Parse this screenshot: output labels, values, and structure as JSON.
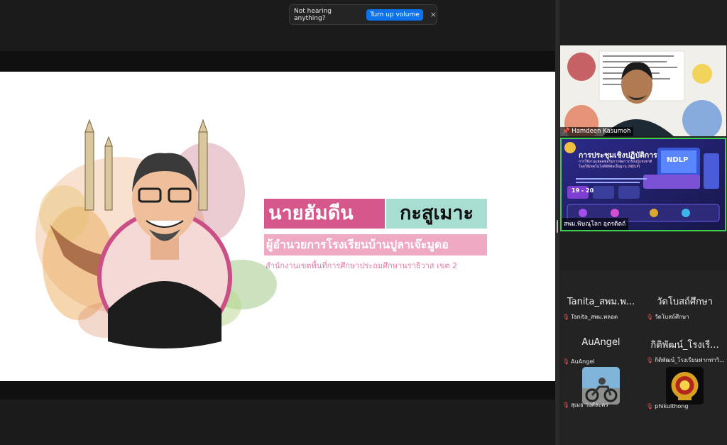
{
  "notification": {
    "message": "Not hearing anything?",
    "action_label": "Turn up volume",
    "close_glyph": "×"
  },
  "slide": {
    "first_name": "นายฮัมดีน",
    "last_name": "กะสูเมาะ",
    "position": "ผู้อำนวยการโรงเรียนบ้านปูลาเจ๊ะมูดอ",
    "office": "สำนักงานเขตพื้นที่การศึกษาประถมศึกษานราธิวาส เขต 2",
    "colors": {
      "pink": "#d6578b",
      "mint": "#a8ded2",
      "light_pink": "#efa9c3"
    }
  },
  "videos": [
    {
      "name": "Hamdeen Kasumoh",
      "muted": false
    },
    {
      "name": "สพม.พิษณุโลก อุตรดิตถ์",
      "muted": false,
      "active_speaker": true,
      "poster": {
        "title": "การประชุมเชิงปฏิบัติการ",
        "subtitle": "การใช้งานแพลตฟอร์มการจัดการเรียนรู้แห่งชาติ โดยใช้เทคโนโลยีดิจิทัลเป็นฐาน (NDLP)",
        "badge": "NDLP",
        "date": "19 - 20"
      }
    }
  ],
  "participants": [
    {
      "display": "Tanita_สพม.พ...",
      "label": "Tanita_สพม.พลอต",
      "muted": true,
      "avatar": ""
    },
    {
      "display": "วัดโบสถ์ศึกษา",
      "label": "วัดโบสถ์ศึกษา",
      "muted": true,
      "avatar": ""
    },
    {
      "display": "AuAngel",
      "label": "AuAngel",
      "muted": true,
      "avatar": ""
    },
    {
      "display": "กิติพัฒน์_โรงเรี...",
      "label": "กิติพัฒน์_โรงเรียนฟากท่าวิ...",
      "muted": true,
      "avatar": ""
    },
    {
      "display": "",
      "label": "สุเมธ วงศ์ละคร",
      "muted": true,
      "avatar": "photo-motorbike"
    },
    {
      "display": "",
      "label": "phikulthong",
      "muted": true,
      "avatar": "school-emblem"
    }
  ],
  "icons": {
    "mic_muted": "🎙",
    "pin": "📌"
  }
}
